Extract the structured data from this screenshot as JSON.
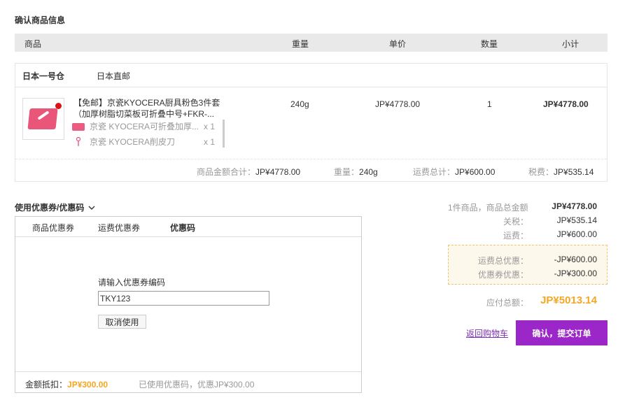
{
  "section_title": "确认商品信息",
  "table_headers": {
    "product": "商品",
    "weight": "重量",
    "unit_price": "单价",
    "quantity": "数量",
    "subtotal": "小计"
  },
  "warehouse": {
    "name": "日本一号仓",
    "shipping": "日本直邮"
  },
  "product": {
    "title": "【免邮】京瓷KYOCERA厨具粉色3件套（加厚树脂切菜板可折叠中号+FKR-...",
    "weight": "240g",
    "unit_price": "JP¥4778.00",
    "quantity": "1",
    "subtotal": "JP¥4778.00",
    "sub_items": [
      {
        "name": "京瓷 KYOCERA可折叠加厚...",
        "qty": "x 1"
      },
      {
        "name": "京瓷 KYOCERA削皮刀",
        "qty": "x 1"
      }
    ]
  },
  "summary": {
    "amount_label": "商品金额合计：",
    "amount": "JP¥4778.00",
    "weight_label": "重量：",
    "weight": "240g",
    "shipping_label": "运费总计：",
    "shipping": "JP¥600.00",
    "tax_label": "税费：",
    "tax": "JP¥535.14"
  },
  "coupon": {
    "toggle_label": "使用优惠券/优惠码",
    "tabs": [
      "商品优惠券",
      "运费优惠券",
      "优惠码"
    ],
    "input_label": "请输入优惠券编码",
    "input_value": "TKY123",
    "cancel_label": "取消使用",
    "deduct_label": "金额抵扣：",
    "deduct_value": "JP¥300.00",
    "used_text": "已使用优惠码，优惠JP¥300.00"
  },
  "totals": {
    "items_label": "1件商品，商品总金额",
    "items_value": "JP¥4778.00",
    "tax_label": "关税：",
    "tax_value": "JP¥535.14",
    "shipping_label": "运费：",
    "shipping_value": "JP¥600.00",
    "ship_discount_label": "运费总优惠：",
    "ship_discount_value": "-JP¥600.00",
    "coupon_discount_label": "优惠券优惠：",
    "coupon_discount_value": "-JP¥300.00",
    "payable_label": "应付总额：",
    "payable_value": "JP¥5013.14"
  },
  "actions": {
    "back_label": "返回购物车",
    "submit_label": "确认，提交订单"
  },
  "colors": {
    "accent": "#9b27c9",
    "highlight": "#f5a623",
    "link": "#7b2fb3"
  }
}
